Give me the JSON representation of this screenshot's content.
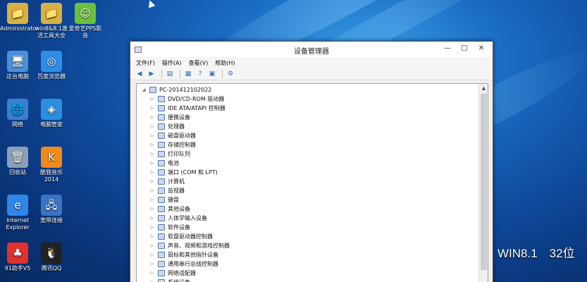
{
  "desktop_icons": [
    {
      "label": "Administrator",
      "glyph": "📁"
    },
    {
      "label": "win8&8.1激活工具大全",
      "glyph": "📁"
    },
    {
      "label": "爱奇艺PPS影音",
      "glyph": "☺"
    },
    {
      "label": "这台电脑",
      "glyph": "🖥"
    },
    {
      "label": "百度浏览器",
      "glyph": "◎"
    },
    {
      "label": "网络",
      "glyph": "🌐"
    },
    {
      "label": "电脑管家",
      "glyph": "◈"
    },
    {
      "label": "回收站",
      "glyph": "🗑"
    },
    {
      "label": "酷我音乐2014",
      "glyph": "K"
    },
    {
      "label": "Internet Explorer",
      "glyph": "e"
    },
    {
      "label": "宽带连接",
      "glyph": "🖧"
    },
    {
      "label": "91助手V5",
      "glyph": "♣"
    },
    {
      "label": "腾讯QQ",
      "glyph": "🐧"
    }
  ],
  "watermark": "WIN8.1　32位",
  "window": {
    "title": "设备管理器",
    "minimize": "—",
    "maximize": "□",
    "close": "✕",
    "menu": [
      "文件(F)",
      "操作(A)",
      "查看(V)",
      "帮助(H)"
    ],
    "toolbar": [
      "◀",
      "▶",
      "▤",
      "▦",
      "?",
      "▣",
      "⚙"
    ],
    "tree_root": "PC-20141210​2022",
    "tree_items": [
      "DVD/CD-ROM 驱动器",
      "IDE ATA/ATAPI 控制器",
      "便携设备",
      "处理器",
      "磁盘驱动器",
      "存储控制器",
      "打印队列",
      "电池",
      "端口 (COM 和 LPT)",
      "计算机",
      "监视器",
      "键盘",
      "其他设备",
      "人体学输入设备",
      "软件设备",
      "软盘驱动器控制器",
      "声音、视频和游戏控制器",
      "鼠标和其他指针设备",
      "通用串行总线控制器",
      "网络适配器",
      "系统设备"
    ]
  }
}
